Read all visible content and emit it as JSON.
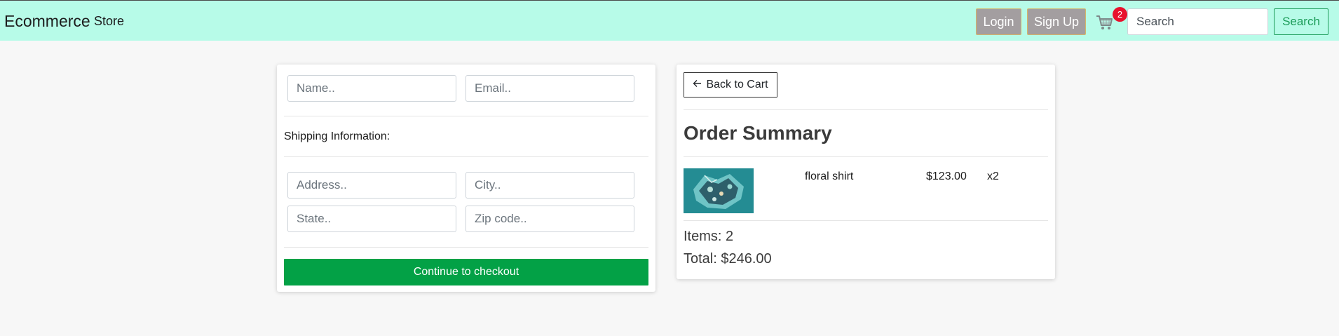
{
  "navbar": {
    "brand": "Ecommerce",
    "store_link": "Store",
    "login_label": "Login",
    "signup_label": "Sign Up",
    "cart_icon": "cart-icon",
    "cart_count": "2",
    "search_placeholder": "Search",
    "search_button": "Search",
    "background_color": "#b7fbe8"
  },
  "checkout_form": {
    "name_placeholder": "Name..",
    "email_placeholder": "Email..",
    "shipping_label": "Shipping Information:",
    "address_placeholder": "Address..",
    "city_placeholder": "City..",
    "state_placeholder": "State..",
    "zip_placeholder": "Zip code..",
    "checkout_button": "Continue to checkout",
    "checkout_color": "#03a146"
  },
  "order_summary": {
    "back_button": "Back to Cart",
    "back_icon": "arrow-left-icon",
    "title": "Order Summary",
    "items": [
      {
        "name": "floral shirt",
        "price": "$123.00",
        "quantity": "x2",
        "image": "floral-shirt-thumbnail"
      }
    ],
    "items_count": "Items: 2",
    "total": "Total: $246.00"
  }
}
